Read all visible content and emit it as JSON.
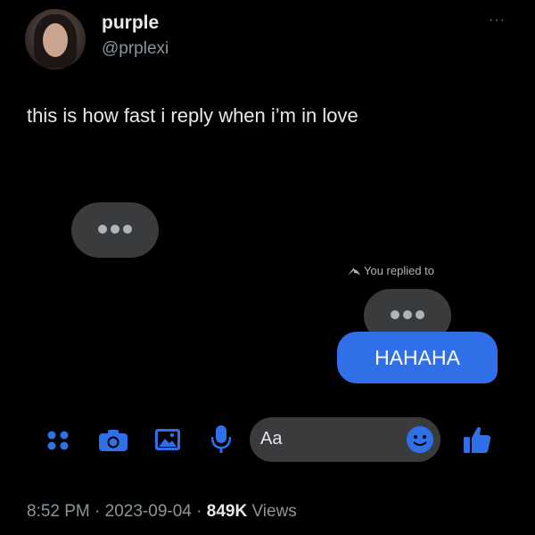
{
  "tweet": {
    "display_name": "purple",
    "handle": "@prplexi",
    "more": "···",
    "text": "this is how fast i reply when i’m in love",
    "time": "8:52 PM",
    "sep1": " · ",
    "date": "2023-09-04",
    "sep2": " · ",
    "views_count": "849K",
    "views_label": " Views"
  },
  "messenger": {
    "replied_label": "You replied to",
    "message": "HAHAHA",
    "input_placeholder": "Aa",
    "icons": [
      "grid-icon",
      "camera-icon",
      "image-icon",
      "microphone-icon",
      "emoji-icon",
      "thumbs-up-icon"
    ],
    "accent": "#2f6fe8",
    "bubble_gray": "#3a3b3c"
  }
}
